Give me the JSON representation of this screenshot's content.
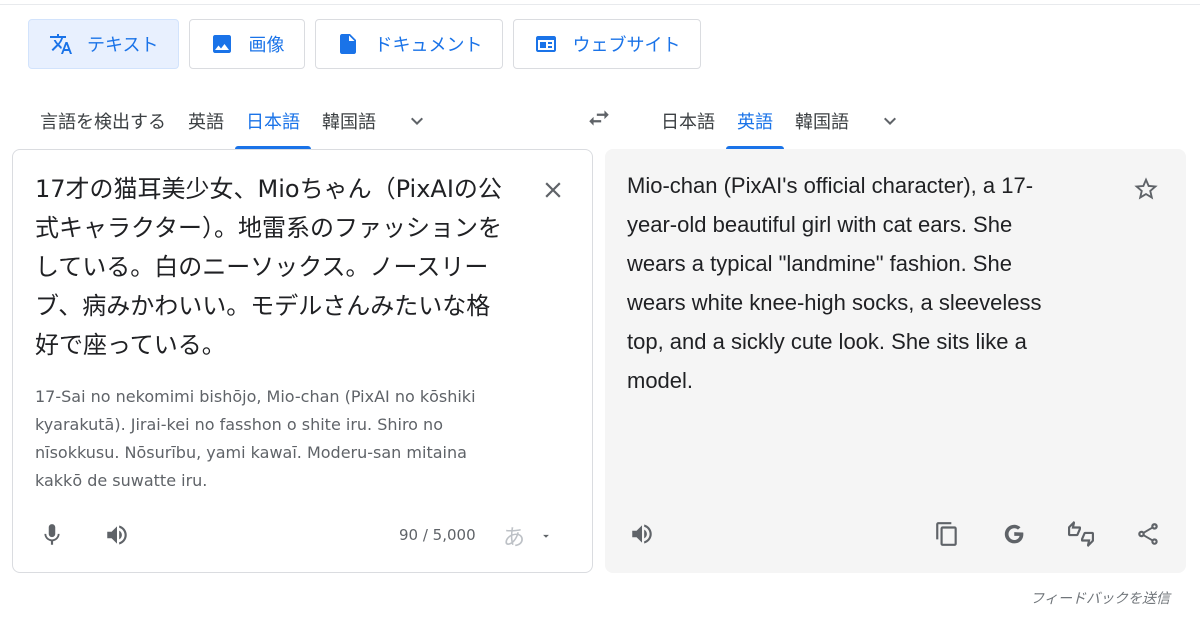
{
  "modes": [
    {
      "label": "テキスト",
      "icon": "translate-icon",
      "active": true
    },
    {
      "label": "画像",
      "icon": "image-icon",
      "active": false
    },
    {
      "label": "ドキュメント",
      "icon": "document-icon",
      "active": false
    },
    {
      "label": "ウェブサイト",
      "icon": "website-icon",
      "active": false
    }
  ],
  "source_langs": {
    "detect": "言語を検出する",
    "items": [
      "英語",
      "日本語",
      "韓国語"
    ],
    "active": "日本語"
  },
  "target_langs": {
    "items": [
      "日本語",
      "英語",
      "韓国語"
    ],
    "active": "英語"
  },
  "source": {
    "text": "17才の猫耳美少女、Mioちゃん（PixAIの公\n式キャラクター）。地雷系のファッションを\nしている。白のニーソックス。ノースリー\nブ、病みかわいい。モデルさんみたいな格\n好で座っている。",
    "transliteration": "17-Sai no nekomimi bishōjo, Mio-chan (PixAI no kōshiki\nkyarakutā). Jirai-kei no fasshon o shite iru. Shiro no\nnīsokkusu. Nōsurību, yami kawaī. Moderu-san mitaina\nkakkō de suwatte iru.",
    "char_count": "90 / 5,000",
    "ime_glyph": "あ"
  },
  "target": {
    "text": "Mio-chan (PixAI's official character), a 17-\nyear-old beautiful girl with cat ears. She\nwears a typical \"landmine\" fashion. She\nwears white knee-high socks, a sleeveless\ntop, and a sickly cute look. She sits like a\nmodel."
  },
  "feedback_label": "フィードバックを送信",
  "colors": {
    "accent": "#1a73e8",
    "active_chip_bg": "#e8f0fe",
    "target_panel_bg": "#f5f5f5"
  }
}
